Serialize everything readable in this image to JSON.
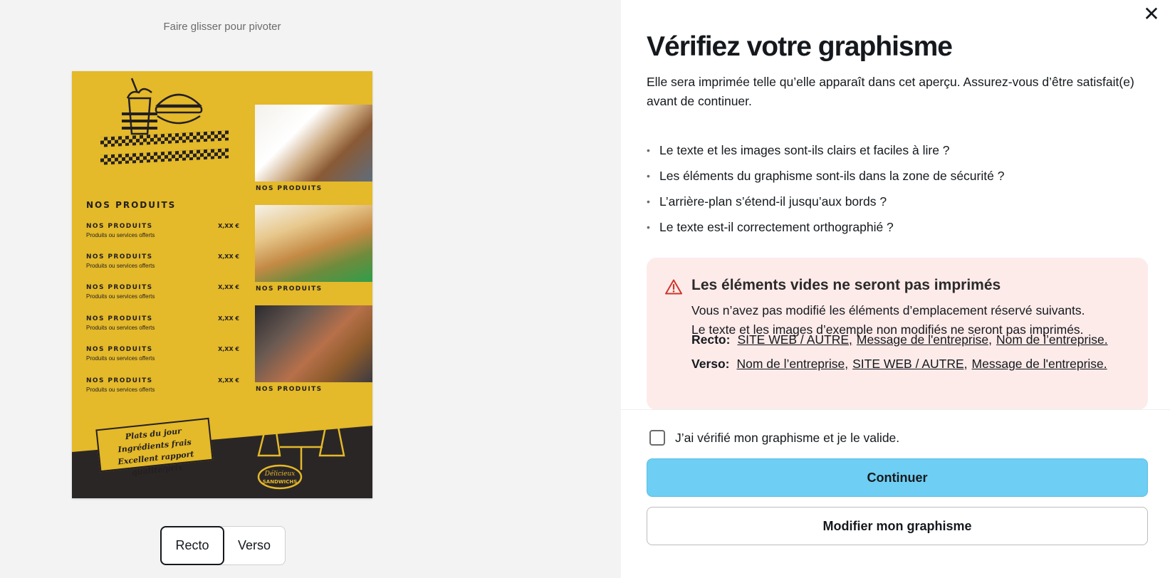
{
  "preview": {
    "hint": "Faire glisser pour pivoter",
    "flyer": {
      "section_title": "NOS PRODUITS",
      "menu_items": [
        {
          "name": "NOS PRODUITS",
          "desc": "Produits ou services offerts",
          "price": "X,XX €"
        },
        {
          "name": "NOS PRODUITS",
          "desc": "Produits ou services offerts",
          "price": "X,XX €"
        },
        {
          "name": "NOS PRODUITS",
          "desc": "Produits ou services offerts",
          "price": "X,XX €"
        },
        {
          "name": "NOS PRODUITS",
          "desc": "Produits ou services offerts",
          "price": "X,XX €"
        },
        {
          "name": "NOS PRODUITS",
          "desc": "Produits ou services offerts",
          "price": "X,XX €"
        },
        {
          "name": "NOS PRODUITS",
          "desc": "Produits ou services offerts",
          "price": "X,XX €"
        }
      ],
      "photo_labels": [
        "NOS PRODUITS",
        "NOS PRODUITS",
        "NOS PRODUITS"
      ],
      "slogan": [
        "Plats du jour",
        "Ingrédients frais",
        "Excellent rapport qualité/prix"
      ],
      "badge": [
        "Délicieux",
        "SANDWICHS"
      ]
    },
    "sides": {
      "front": "Recto",
      "back": "Verso",
      "selected": "Recto"
    }
  },
  "panel": {
    "close_icon": "close-icon",
    "title": "Vérifiez votre graphisme",
    "intro": "Elle sera imprimée telle qu’elle apparaît dans cet aperçu. Assurez-vous d’être satisfait(e) avant de continuer.",
    "checklist": [
      "Le texte et les images sont-ils clairs et faciles à lire ?",
      "Les éléments du graphisme sont-ils dans la zone de sécurité ?",
      "L’arrière-plan s’étend-il jusqu’aux bords ?",
      "Le texte est-il correctement orthographié ?"
    ],
    "alert": {
      "icon": "warning-icon",
      "title": "Les éléments vides ne seront pas imprimés",
      "body_line1": "Vous n’avez pas modifié les éléments d’emplacement réservé suivants.",
      "body_line2": "Le texte et les images d’exemple non modifiés ne seront pas imprimés.",
      "front_label": "Recto:",
      "front_links": [
        "SITE WEB / AUTRE,",
        "Message de l'entreprise,",
        "Nom de l’entreprise."
      ],
      "back_label": "Verso:",
      "back_links": [
        "Nom de l’entreprise,",
        "SITE WEB / AUTRE,",
        "Message de l'entreprise."
      ]
    },
    "confirm_label": "J’ai vérifié mon graphisme et je le valide.",
    "confirm_checked": false,
    "continue_label": "Continuer",
    "edit_label": "Modifier mon graphisme",
    "colors": {
      "accent": "#6fcef3",
      "alert_bg": "#fdebea",
      "alert_icon": "#d0352b",
      "flyer_yellow": "#e4b92a",
      "flyer_dark": "#2b2626"
    }
  }
}
